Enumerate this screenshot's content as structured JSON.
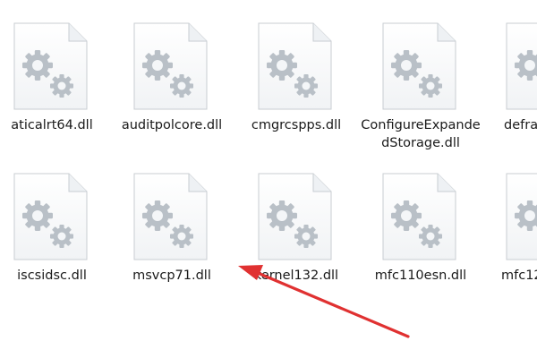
{
  "files": [
    {
      "name": "aticalrt64.dll"
    },
    {
      "name": "auditpolcore.dll"
    },
    {
      "name": "cmgrcspps.dll"
    },
    {
      "name": "ConfigureExpandedStorage.dll"
    },
    {
      "name": "defra"
    },
    {
      "name": "iscsidsc.dll"
    },
    {
      "name": "msvcp71.dll"
    },
    {
      "name": "kernel132.dll"
    },
    {
      "name": "mfc110esn.dll"
    },
    {
      "name": "mfc12"
    }
  ],
  "annotation": {
    "arrow_color": "#e03131",
    "arrow_target": "msvcp71.dll"
  },
  "icon": "dll-settings-file-icon"
}
